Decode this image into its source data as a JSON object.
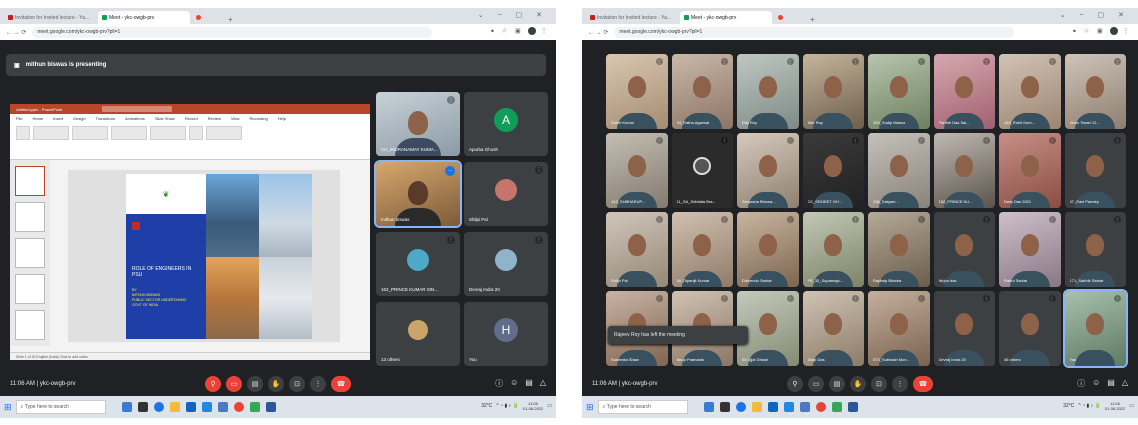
{
  "left": {
    "tabs": [
      "Invitation for Invited lecture - Ya...",
      "Meet - ykc-owgb-prv",
      ""
    ],
    "url": "meet.google.com/ykc-owgb-prv?pli=1",
    "presenting_banner": "mithun biswas is presenting",
    "ppt": {
      "title": "Untitled.pptx - PowerPoint",
      "ribbon_tabs": [
        "File",
        "Home",
        "Insert",
        "Design",
        "Transitions",
        "Animations",
        "Slide Show",
        "Record",
        "Review",
        "View",
        "Recording",
        "Help"
      ],
      "slide_title": "ROLE OF ENGINEERS IN PSU",
      "slide_sub": [
        "BY",
        "MITHUN BISWAS",
        "PUBLIC SECTOR UNDERTAKING",
        "GOVT OF INDIA"
      ],
      "status": "Slide 1 of 20   English (India)   Click to add notes"
    },
    "tiles": [
      {
        "name": "CH_INDRANAMAY KUMA..."
      },
      {
        "name": "Apurba Ghosh",
        "initial": "A",
        "color": "#0f9d58"
      },
      {
        "name": "mithun biswas"
      },
      {
        "name": "Shilpi Pal"
      },
      {
        "name": "162_PRINCE KUMAR SIN..."
      },
      {
        "name": "Devraj Indra 20"
      },
      {
        "name": "13 others"
      },
      {
        "name": "You",
        "initial": "H",
        "color": "#5f6d8a"
      }
    ],
    "time": "11:06 AM",
    "meeting_code": "ykc-owgb-prv",
    "search_placeholder": "Type here to search",
    "tray": {
      "temp": "32°C",
      "clock": "11:06",
      "date": "01-08-2022"
    }
  },
  "right": {
    "tabs": [
      "Invitation for Invited lecture - Ya...",
      "Meet - ykc-owgb-prv",
      ""
    ],
    "url": "meet.google.com/ykc-owgb-prv?pli=1",
    "tiles": [
      {
        "name": "Sumit Kumar",
        "c1": "#d9c7b0",
        "c2": "#a58c74"
      },
      {
        "name": "04_Ratha Agarwal",
        "c1": "#c9b8a8",
        "c2": "#8c7565"
      },
      {
        "name": "Dilp Roy",
        "c1": "#bfc7c2",
        "c2": "#7e8a86"
      },
      {
        "name": "Abir Roy",
        "c1": "#c5b59d",
        "c2": "#6d5e4c"
      },
      {
        "name": "100_Sudip Manna",
        "c1": "#b7c5ad",
        "c2": "#6e8061"
      },
      {
        "name": "Parthib Das Sai...",
        "c1": "#d6a8b0",
        "c2": "#a0616e"
      },
      {
        "name": "183_Rohit Kum...",
        "c1": "#d2c3b6",
        "c2": "#9b8572"
      },
      {
        "name": "Vivek Tiwari 12...",
        "c1": "#cfc4b9",
        "c2": "#8d7e70"
      },
      {
        "name": "143_SUBHARUP...",
        "c1": "#c4beb3",
        "c2": "#837a6d"
      },
      {
        "name": "11_SA_Sriidatta Bra...",
        "logo": true
      },
      {
        "name": "Sreyasha Bhowa...",
        "c1": "#d5c9bd",
        "c2": "#8f8070"
      },
      {
        "name": "CK_SRIJEET GH...",
        "c1": "#3a3a3a",
        "c2": "#222"
      },
      {
        "name": "136_Satyam ...",
        "c1": "#c5c0ba",
        "c2": "#8a837b"
      },
      {
        "name": "162_PRINCE KU...",
        "c1": "#bfb9b3",
        "c2": "#5b544c"
      },
      {
        "name": "Dwip Das 2021",
        "c1": "#c78f86",
        "c2": "#8a4d44"
      },
      {
        "name": "47_Ravi Pandey",
        "c1": "#3c4043",
        "c2": "#3c4043"
      },
      {
        "name": "Shilpi Pal",
        "c1": "#cfc6ba",
        "c2": "#958876"
      },
      {
        "name": "60_Dipanjit Kumar",
        "c1": "#d1c0b0",
        "c2": "#8f7b68"
      },
      {
        "name": "Dibyendu Sarkar",
        "c1": "#c9b59f",
        "c2": "#7c6651"
      },
      {
        "name": "FE_33_Suparnajo...",
        "c1": "#c2c7b4",
        "c2": "#7d8468"
      },
      {
        "name": "Rajdwip Bhadra",
        "c1": "#b5a998",
        "c2": "#6a5d4c"
      },
      {
        "name": "Nirjon das",
        "c1": "#3c4043",
        "c2": "#3c4043"
      },
      {
        "name": "Rahul Sarkar",
        "c1": "#cdbfc9",
        "c2": "#8a7786"
      },
      {
        "name": "171_Sabhik Sarkar",
        "c1": "#3c4043",
        "c2": "#3c4043"
      },
      {
        "name": "Sushmita Shaw",
        "c1": "#c9b3a2",
        "c2": "#7f6552"
      },
      {
        "name": "Anup Pramanik",
        "c1": "#d0c2b3",
        "c2": "#8a7665"
      },
      {
        "name": "04 Ujjal Ghosh",
        "c1": "#c6c9bb",
        "c2": "#858a74"
      },
      {
        "name": "Dwip Das",
        "c1": "#cfc3b5",
        "c2": "#8d7b67"
      },
      {
        "name": "073_Subhash Mon...",
        "c1": "#c4b09d",
        "c2": "#7a6350"
      },
      {
        "name": "Devraj Indra 20",
        "c1": "#3c4043",
        "c2": "#3c4043"
      },
      {
        "name": "46 others",
        "c1": "#3c4043",
        "c2": "#3c4043"
      },
      {
        "name": "You",
        "c1": "#a8c0ac",
        "c2": "#5e7a63"
      }
    ],
    "toast": "Rajeev Roy has left the meeting",
    "time": "11:06 AM",
    "meeting_code": "ykc-owgb-prv",
    "search_placeholder": "Type here to search",
    "tray": {
      "temp": "32°C",
      "clock": "11:06",
      "date": "01-08-2022"
    }
  }
}
